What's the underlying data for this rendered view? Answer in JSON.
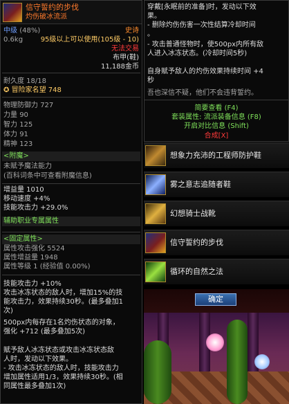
{
  "item": {
    "name": "信守誓约的步伐",
    "set_name": "灼伤破冰流派",
    "grade": "中级",
    "grade_pct": "(48%)",
    "rarity": "史诗",
    "weight": "0.6kg",
    "level_req": "95级以上可以使用(105级 - 10)",
    "trade": "无法交易",
    "slot": "布甲(鞋)",
    "price": "11,188金币",
    "durability": "耐久度 18/18",
    "adventurer_fame": "冒险家名望 748"
  },
  "stats": [
    {
      "label": "物理防御力",
      "value": "727"
    },
    {
      "label": "力量",
      "value": "90"
    },
    {
      "label": "智力",
      "value": "125"
    },
    {
      "label": "体力",
      "value": "91"
    },
    {
      "label": "精神",
      "value": "123"
    }
  ],
  "enchant": {
    "header": "<附魔>",
    "none": "未赋予魔法能力",
    "hint": "(百科词条中可查看附魔信息)"
  },
  "bonus_stats": [
    "增益量 1010",
    "移动速度 +4%",
    "技能攻击力 +29.0%"
  ],
  "aux_job_attr": "辅助职业专属属性",
  "fixed": {
    "header": "<固定属性>",
    "lines": [
      "属性攻击强化 5524",
      "属性增益量 1948",
      "属性等级 1 (经验值 0.00%)"
    ]
  },
  "effect_lines": [
    "技能攻击力 +10%",
    "攻击冰冻状态的敌人时，增加15%的技",
    "能攻击力，效果持续30秒。(最多叠加1",
    "次)",
    "500px内每存在1名灼伤状态的对象，",
    "强化 +712 (最多叠加5次)",
    "",
    "赋予敌人冰冻状态或攻击冰冻状态敌",
    "人时，发动以下效果。",
    "- 攻击冰冻状态的敌人时，技能攻击力",
    "增加属性适用1/3，效果持续30秒。(相",
    "同属性最多叠加1次)"
  ],
  "right_panel": {
    "lines": [
      "穿戴[永眠前的准备]时，发动以下效",
      "果。",
      "- 删除灼伤伤害一次性结算冷却时间",
      "。",
      "- 攻击普通怪物时，使500px内所有敌",
      "人进入冰冻状态。(冷却时间5秒)",
      "",
      "自身赋予敌人的灼伤效果持续时间 +4",
      "秒",
      "吾也深信不疑，他们不会违背誓约。"
    ],
    "brief_view": "简要查看 (F4)",
    "set_info": "套装属性: 流派装备信息 (F8)",
    "compare": "开启对比信息 (Shift)",
    "synthesis": "合成[X]"
  },
  "set_items": [
    {
      "name": "想象力充沛的工程师防护鞋",
      "icon": "engineer-shoes-icon"
    },
    {
      "name": "雾之意志追随者鞋",
      "icon": "mist-boots-icon"
    },
    {
      "name": "幻想骑士战靴",
      "icon": "knight-boots-icon"
    },
    {
      "name": "信守誓约的步伐",
      "icon": "oath-steps-icon"
    },
    {
      "name": "循环的自然之法",
      "icon": "nature-law-icon"
    }
  ],
  "confirm_label": "确定"
}
